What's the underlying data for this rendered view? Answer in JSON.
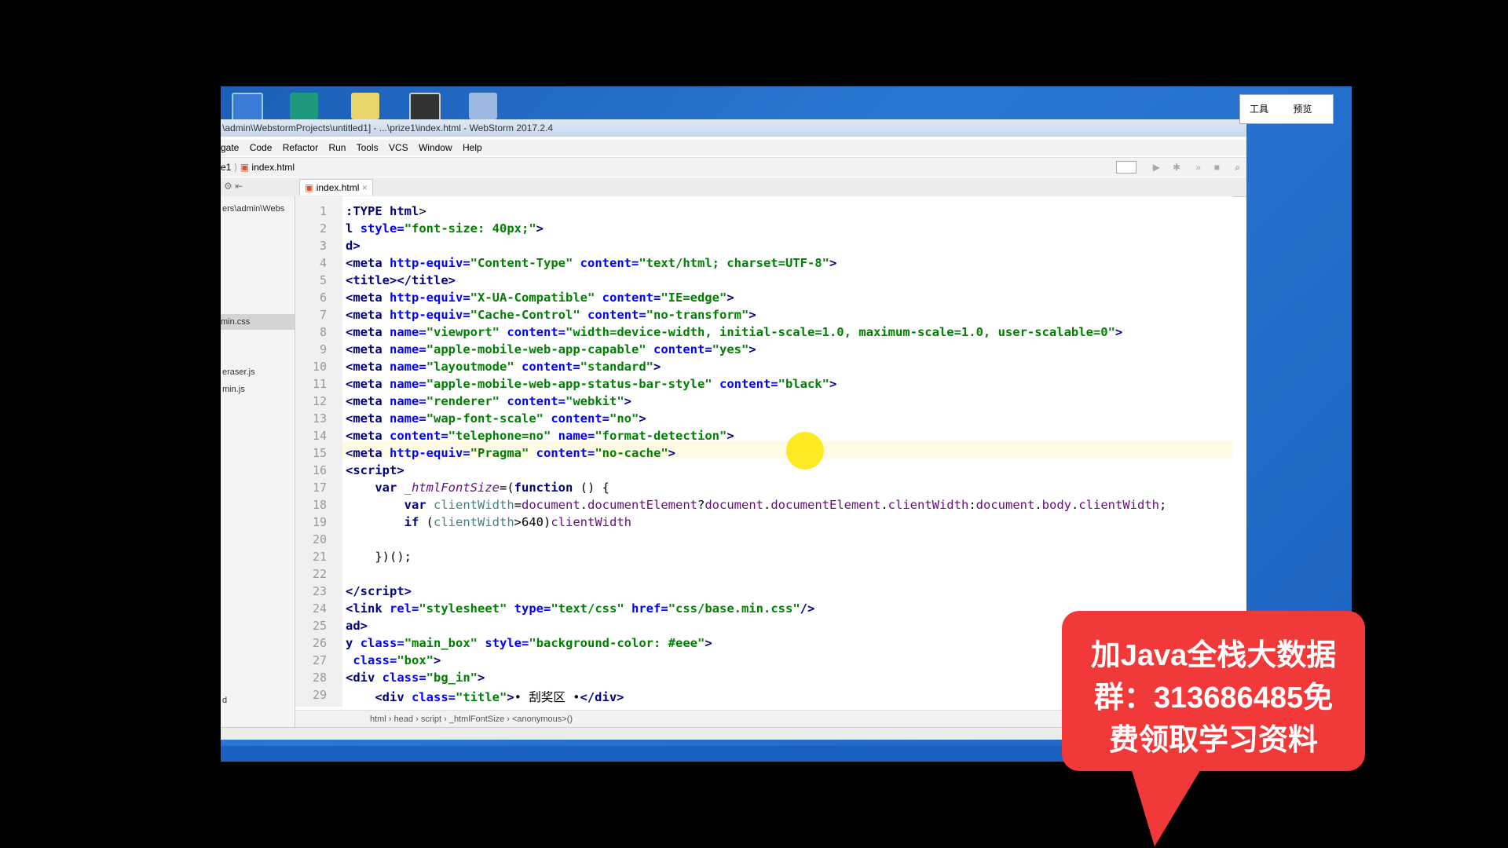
{
  "window_title": "\\admin\\WebstormProjects\\untitled1] - ...\\prize1\\index.html - WebStorm 2017.2.4",
  "menu": [
    "gate",
    "Code",
    "Refactor",
    "Run",
    "Tools",
    "VCS",
    "Window",
    "Help"
  ],
  "nav": {
    "project": "e1",
    "file": "index.html"
  },
  "tab": {
    "label": "index.html"
  },
  "project_tree": {
    "path": "ers\\admin\\Webs",
    "items": [
      "min.css",
      "eraser.js",
      "min.js"
    ],
    "bottom_item": "d"
  },
  "code_lines": [
    {
      "n": "1",
      "html": "<span class='tag'>:TYPE html</span>&gt;"
    },
    {
      "n": "2",
      "html": "<span class='tag'>l</span> <span class='attr'>style=</span><span class='str'>\"font-size: 40px;\"</span><span class='tag'>&gt;</span>"
    },
    {
      "n": "3",
      "html": "<span class='tag'>d&gt;</span>"
    },
    {
      "n": "4",
      "html": "<span class='tag'>&lt;meta</span> <span class='attr'>http-equiv=</span><span class='str'>\"Content-Type\"</span> <span class='attr'>content=</span><span class='str'>\"text/html; charset=UTF-8\"</span><span class='tag'>&gt;</span>"
    },
    {
      "n": "5",
      "html": "<span class='tag'>&lt;title&gt;&lt;/title&gt;</span>"
    },
    {
      "n": "6",
      "html": "<span class='tag'>&lt;meta</span> <span class='attr'>http-equiv=</span><span class='str'>\"X-UA-Compatible\"</span> <span class='attr'>content=</span><span class='str'>\"IE=edge\"</span><span class='tag'>&gt;</span>"
    },
    {
      "n": "7",
      "html": "<span class='tag'>&lt;meta</span> <span class='attr'>http-equiv=</span><span class='str'>\"Cache-Control\"</span> <span class='attr'>content=</span><span class='str'>\"no-transform\"</span><span class='tag'>&gt;</span>"
    },
    {
      "n": "8",
      "html": "<span class='tag'>&lt;meta</span> <span class='attr'>name=</span><span class='str'>\"viewport\"</span> <span class='attr'>content=</span><span class='str'>\"width=device-width, initial-scale=1.0, maximum-scale=1.0, user-scalable=0\"</span><span class='tag'>&gt;</span>"
    },
    {
      "n": "9",
      "html": "<span class='tag'>&lt;meta</span> <span class='attr'>name=</span><span class='str'>\"apple-mobile-web-app-capable\"</span> <span class='attr'>content=</span><span class='str'>\"yes\"</span><span class='tag'>&gt;</span>"
    },
    {
      "n": "10",
      "html": "<span class='tag'>&lt;meta</span> <span class='attr'>name=</span><span class='str'>\"layoutmode\"</span> <span class='attr'>content=</span><span class='str'>\"standard\"</span><span class='tag'>&gt;</span>"
    },
    {
      "n": "11",
      "html": "<span class='tag'>&lt;meta</span> <span class='attr'>name=</span><span class='str'>\"apple-mobile-web-app-status-bar-style\"</span> <span class='attr'>content=</span><span class='str'>\"black\"</span><span class='tag'>&gt;</span>"
    },
    {
      "n": "12",
      "html": "<span class='tag'>&lt;meta</span> <span class='attr'>name=</span><span class='str'>\"renderer\"</span> <span class='attr'>content=</span><span class='str'>\"webkit\"</span><span class='tag'>&gt;</span>"
    },
    {
      "n": "13",
      "html": "<span class='tag'>&lt;meta</span> <span class='attr'>name=</span><span class='str'>\"wap-font-scale\"</span> <span class='attr'>content=</span><span class='str'>\"no\"</span><span class='tag'>&gt;</span>"
    },
    {
      "n": "14",
      "html": "<span class='tag'>&lt;meta</span> <span class='attr'>content=</span><span class='str'>\"telephone=no\"</span> <span class='attr'>name=</span><span class='str'>\"format-detection\"</span><span class='tag'>&gt;</span>"
    },
    {
      "n": "15",
      "html": "<span class='tag'>&lt;meta</span> <span class='attr'>http-equiv=</span><span class='str'>\"Pragma\"</span> <span class='attr'>content=</span><span class='str'>\"no-cache\"</span><span class='tag'>&gt;</span>"
    },
    {
      "n": "16",
      "html": "<span class='tag'>&lt;script&gt;</span>"
    },
    {
      "n": "17",
      "html": "    <span class='kw'>var</span> <span class='it'>_htmlFontSize</span>=(<span class='kw'>function</span> () {"
    },
    {
      "n": "18",
      "html": "        <span class='kw'>var</span> <span class='var'>clientWidth</span>=<span class='id'>document</span>.<span class='id'>documentElement</span>?<span class='id'>document</span>.<span class='id'>documentElement</span>.<span class='id'>clientWidth</span>:<span class='id'>document</span>.<span class='id'>body</span>.<span class='id'>clientWidth</span>;"
    },
    {
      "n": "19",
      "html": "        <span class='kw'>if</span> (<span class='var'>clientWidth</span>&gt;640)<span class='id'>clientWidth</span>"
    },
    {
      "n": "20",
      "html": ""
    },
    {
      "n": "21",
      "html": "    })();"
    },
    {
      "n": "22",
      "html": ""
    },
    {
      "n": "23",
      "html": "<span class='tag'>&lt;/script&gt;</span>"
    },
    {
      "n": "24",
      "html": "<span class='tag'>&lt;link</span> <span class='attr'>rel=</span><span class='str'>\"stylesheet\"</span> <span class='attr'>type=</span><span class='str'>\"text/css\"</span> <span class='attr'>href=</span><span class='str'>\"css/base.min.css\"</span><span class='tag'>/&gt;</span>"
    },
    {
      "n": "25",
      "html": "<span class='tag'>ad&gt;</span>"
    },
    {
      "n": "26",
      "html": "<span class='tag'>y</span> <span class='attr'>class=</span><span class='str'>\"main_box\"</span> <span class='attr'>style=</span><span class='str'>\"background-color: #eee\"</span><span class='tag'>&gt;</span>"
    },
    {
      "n": "27",
      "html": " <span class='attr'>class=</span><span class='str'>\"box\"</span><span class='tag'>&gt;</span>"
    },
    {
      "n": "28",
      "html": "<span class='tag'>&lt;div</span> <span class='attr'>class=</span><span class='str'>\"bg_in\"</span><span class='tag'>&gt;</span>"
    },
    {
      "n": "29",
      "html": "    <span class='tag'>&lt;div</span> <span class='attr'>class=</span><span class='str'>\"title\"</span><span class='tag'>&gt;</span>• 刮奖区 •<span class='tag'>&lt;/div&gt;</span>"
    }
  ],
  "breadcrumbs": [
    "html",
    "head",
    "script",
    "_htmlFontSize",
    "<anonymous>()"
  ],
  "right_panel": {
    "tools": "工具",
    "preview": "预览"
  },
  "ad": {
    "line1": "加Java全栈大数据",
    "line2": "群：313686485免",
    "line3": "费领取学习资料"
  },
  "colors": {
    "ad_bg": "#f2393a",
    "desktop": "#2a78d4"
  }
}
